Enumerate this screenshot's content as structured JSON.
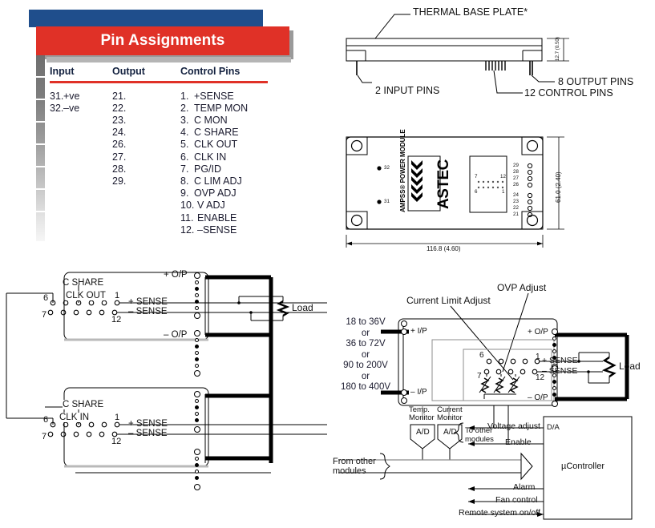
{
  "panel": {
    "title": "Pin Assignments",
    "headers": [
      "Input",
      "Output",
      "Control Pins"
    ],
    "input_pins": [
      {
        "num": "31.",
        "label": "+ve"
      },
      {
        "num": "32.",
        "label": "–ve"
      }
    ],
    "output_pins": [
      "21.",
      "22.",
      "23.",
      "24.",
      "26.",
      "27.",
      "28.",
      "29."
    ],
    "control_pins": [
      {
        "num": "1.",
        "label": "+SENSE"
      },
      {
        "num": "2.",
        "label": "TEMP MON"
      },
      {
        "num": "3.",
        "label": "C MON"
      },
      {
        "num": "4.",
        "label": "C SHARE"
      },
      {
        "num": "5.",
        "label": "CLK OUT"
      },
      {
        "num": "6.",
        "label": "CLK IN"
      },
      {
        "num": "7.",
        "label": "PG/ID"
      },
      {
        "num": "8.",
        "label": "C LIM ADJ"
      },
      {
        "num": "9.",
        "label": "OVP ADJ"
      },
      {
        "num": "10.",
        "label": "V ADJ"
      },
      {
        "num": "11.",
        "label": "ENABLE"
      },
      {
        "num": "12.",
        "label": "–SENSE"
      }
    ],
    "colors": {
      "banner": "#e03127",
      "bar": "#1f4e8c",
      "rule": "#e03127"
    }
  },
  "side_view": {
    "thermal_plate": "THERMAL BASE PLATE*",
    "input_pins": "2 INPUT PINS",
    "output_pins": "8 OUTPUT PINS",
    "control_pins": "12 CONTROL PINS",
    "height_dim": "12.7 (0.50)"
  },
  "top_view": {
    "brand": "ASTEC",
    "product": "AMPSS® POWER MODULE",
    "width_dim": "116.8 (4.60)",
    "height_dim": "61.0 (2.40)",
    "case_pins": [
      "32",
      "31"
    ],
    "output_pin_labels_upper": [
      "29",
      "28",
      "27",
      "26"
    ],
    "output_pin_labels_lower": [
      "24",
      "23",
      "22",
      "21"
    ],
    "connector_corners": {
      "top_left": "7",
      "top_right": "12",
      "bottom_left": "6",
      "bottom_right": "1"
    }
  },
  "parallel_circuit": {
    "module_a": {
      "c_share": "C SHARE",
      "clk": "CLK OUT",
      "pin_top_left": "6",
      "pin_top_right": "1",
      "pin_bot_left": "7",
      "pin_bot_right": "12",
      "plus_op": "+ O/P",
      "minus_op": "– O/P",
      "plus_sense": "+ SENSE",
      "minus_sense": "– SENSE"
    },
    "module_b": {
      "c_share": "C SHARE",
      "clk": "CLK IN",
      "pin_top_left": "6",
      "pin_top_right": "1",
      "pin_bot_left": "7",
      "pin_bot_right": "12",
      "plus_sense": "+ SENSE",
      "minus_sense": "– SENSE"
    },
    "load": "Load"
  },
  "system_circuit": {
    "input_ranges": [
      "18 to 36V",
      "or",
      "36 to 72V",
      "or",
      "90 to 200V",
      "or",
      "180 to 400V"
    ],
    "current_limit_adjust": "Current Limit Adjust",
    "ovp_adjust": "OVP Adjust",
    "plus_ip": "+ I/P",
    "minus_ip": "– I/P",
    "plus_op": "+ O/P",
    "minus_op": "– O/P",
    "plus_sense": "+ SENSE",
    "minus_sense": "– SENSE",
    "pin_top_left": "6",
    "pin_bot_left": "7",
    "pin_right_top": "1",
    "pin_right_bot": "12",
    "load": "Load",
    "temp_monitor": "Temp.\nMonitor",
    "temp_monitor_l1": "Temp.",
    "temp_monitor_l2": "Monitor",
    "current_monitor_l1": "Current",
    "current_monitor_l2": "Monitor",
    "adc": "A/D",
    "dac": "D/A",
    "to_other_l1": "To other",
    "to_other_l2": "modules",
    "from_other_l1": "From other",
    "from_other_l2": "modules",
    "voltage_adjust": "Voltage adjust",
    "enable": "Enable",
    "controller": "µController",
    "alarm": "Alarm",
    "fan_control": "Fan control",
    "remote_onoff": "Remote system on/off"
  }
}
